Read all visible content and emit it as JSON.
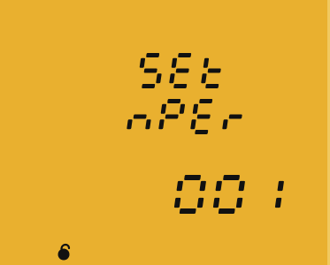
{
  "display": {
    "background_color": "#e9b02f",
    "segment_color": "#111111",
    "line1": "SEt",
    "line2": "nPEr",
    "value": "001"
  },
  "indicators": {
    "lock_icon": "unlock-icon"
  }
}
